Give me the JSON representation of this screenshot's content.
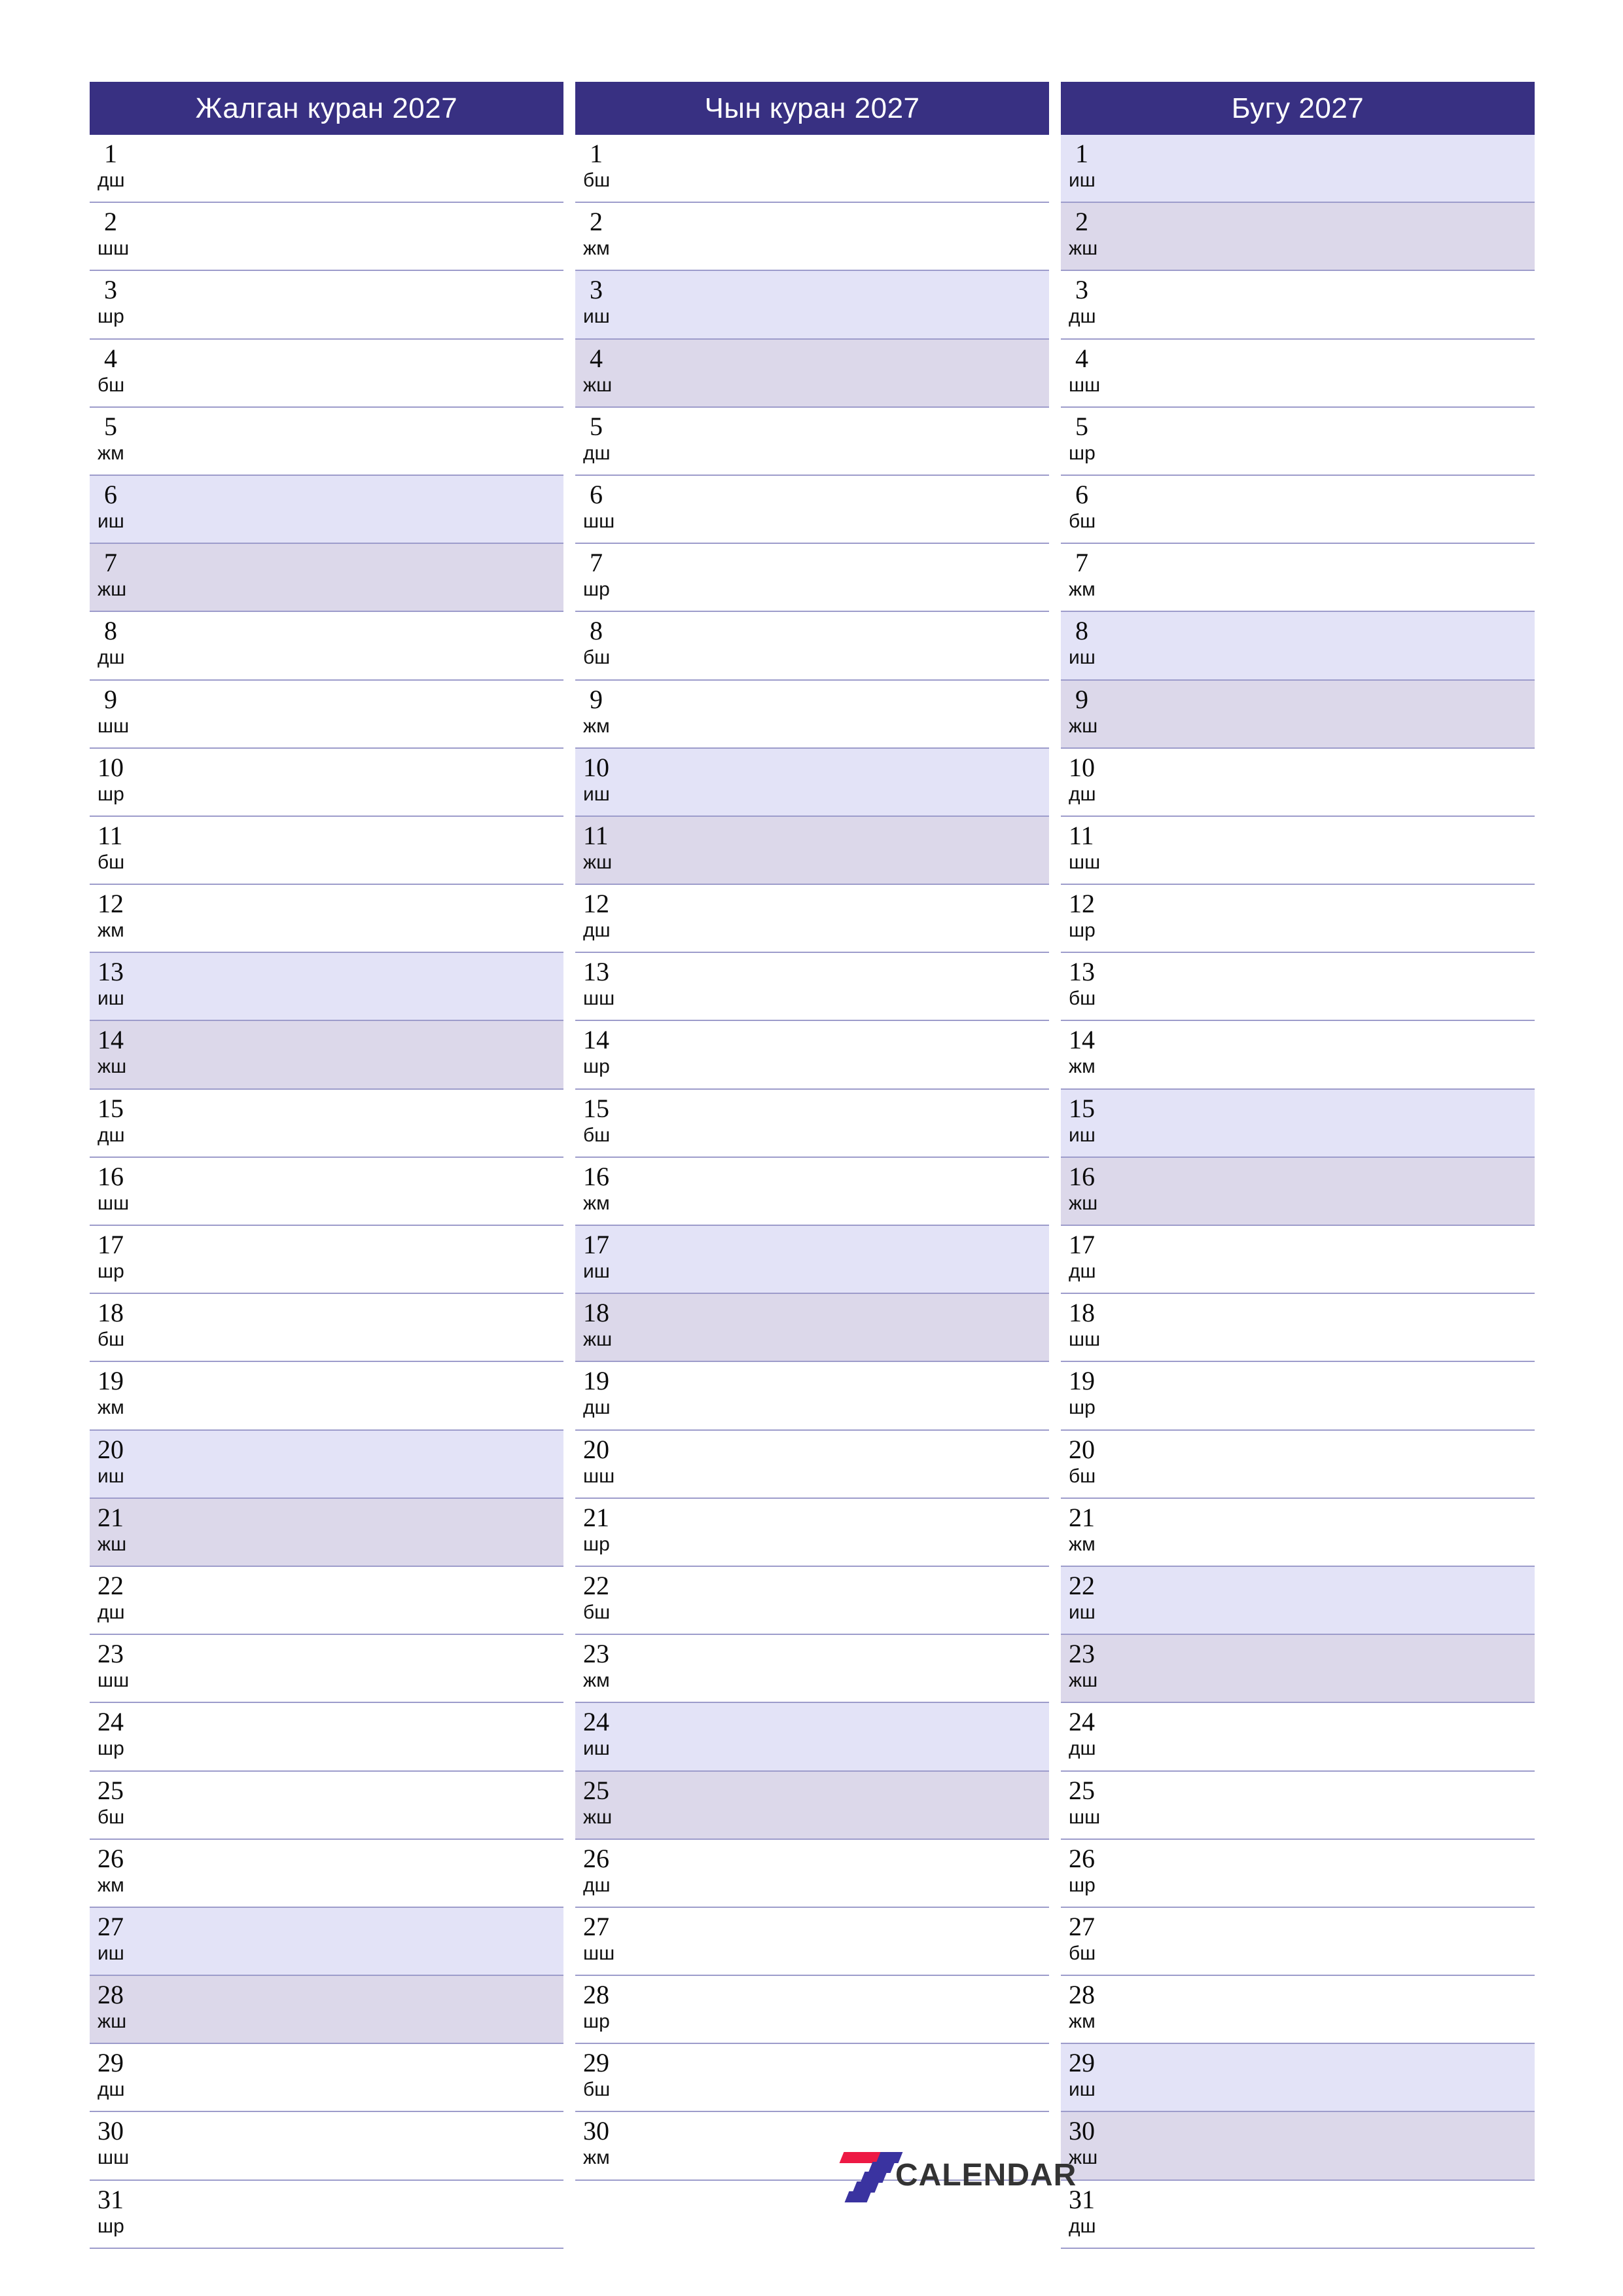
{
  "page": {
    "year": "2027",
    "header_bg": "#383082",
    "saturday_bg": "#e3e3f7",
    "sunday_bg": "#dcd8ea",
    "separator_color": "#9d9ccb"
  },
  "logo": {
    "text": "CALENDAR",
    "mark_colors": [
      "#ed1944",
      "#ed1944",
      "#3a33a0",
      "#3a33a0",
      "#3a33a0",
      "#3a33a0",
      "#3a33a0"
    ]
  },
  "weekday_abbr": {
    "monday": "дш",
    "tuesday": "шш",
    "wednesday": "шр",
    "thursday": "бш",
    "friday": "жм",
    "saturday": "иш",
    "sunday": "жш"
  },
  "months": [
    {
      "title": "Жалган куран 2027",
      "days": [
        {
          "n": "1",
          "d": "дш",
          "t": "wd"
        },
        {
          "n": "2",
          "d": "шш",
          "t": "wd"
        },
        {
          "n": "3",
          "d": "шр",
          "t": "wd"
        },
        {
          "n": "4",
          "d": "бш",
          "t": "wd"
        },
        {
          "n": "5",
          "d": "жм",
          "t": "wd"
        },
        {
          "n": "6",
          "d": "иш",
          "t": "sat"
        },
        {
          "n": "7",
          "d": "жш",
          "t": "sun"
        },
        {
          "n": "8",
          "d": "дш",
          "t": "wd"
        },
        {
          "n": "9",
          "d": "шш",
          "t": "wd"
        },
        {
          "n": "10",
          "d": "шр",
          "t": "wd"
        },
        {
          "n": "11",
          "d": "бш",
          "t": "wd"
        },
        {
          "n": "12",
          "d": "жм",
          "t": "wd"
        },
        {
          "n": "13",
          "d": "иш",
          "t": "sat"
        },
        {
          "n": "14",
          "d": "жш",
          "t": "sun"
        },
        {
          "n": "15",
          "d": "дш",
          "t": "wd"
        },
        {
          "n": "16",
          "d": "шш",
          "t": "wd"
        },
        {
          "n": "17",
          "d": "шр",
          "t": "wd"
        },
        {
          "n": "18",
          "d": "бш",
          "t": "wd"
        },
        {
          "n": "19",
          "d": "жм",
          "t": "wd"
        },
        {
          "n": "20",
          "d": "иш",
          "t": "sat"
        },
        {
          "n": "21",
          "d": "жш",
          "t": "sun"
        },
        {
          "n": "22",
          "d": "дш",
          "t": "wd"
        },
        {
          "n": "23",
          "d": "шш",
          "t": "wd"
        },
        {
          "n": "24",
          "d": "шр",
          "t": "wd"
        },
        {
          "n": "25",
          "d": "бш",
          "t": "wd"
        },
        {
          "n": "26",
          "d": "жм",
          "t": "wd"
        },
        {
          "n": "27",
          "d": "иш",
          "t": "sat"
        },
        {
          "n": "28",
          "d": "жш",
          "t": "sun"
        },
        {
          "n": "29",
          "d": "дш",
          "t": "wd"
        },
        {
          "n": "30",
          "d": "шш",
          "t": "wd"
        },
        {
          "n": "31",
          "d": "шр",
          "t": "wd"
        }
      ]
    },
    {
      "title": "Чын куран 2027",
      "days": [
        {
          "n": "1",
          "d": "бш",
          "t": "wd"
        },
        {
          "n": "2",
          "d": "жм",
          "t": "wd"
        },
        {
          "n": "3",
          "d": "иш",
          "t": "sat"
        },
        {
          "n": "4",
          "d": "жш",
          "t": "sun"
        },
        {
          "n": "5",
          "d": "дш",
          "t": "wd"
        },
        {
          "n": "6",
          "d": "шш",
          "t": "wd"
        },
        {
          "n": "7",
          "d": "шр",
          "t": "wd"
        },
        {
          "n": "8",
          "d": "бш",
          "t": "wd"
        },
        {
          "n": "9",
          "d": "жм",
          "t": "wd"
        },
        {
          "n": "10",
          "d": "иш",
          "t": "sat"
        },
        {
          "n": "11",
          "d": "жш",
          "t": "sun"
        },
        {
          "n": "12",
          "d": "дш",
          "t": "wd"
        },
        {
          "n": "13",
          "d": "шш",
          "t": "wd"
        },
        {
          "n": "14",
          "d": "шр",
          "t": "wd"
        },
        {
          "n": "15",
          "d": "бш",
          "t": "wd"
        },
        {
          "n": "16",
          "d": "жм",
          "t": "wd"
        },
        {
          "n": "17",
          "d": "иш",
          "t": "sat"
        },
        {
          "n": "18",
          "d": "жш",
          "t": "sun"
        },
        {
          "n": "19",
          "d": "дш",
          "t": "wd"
        },
        {
          "n": "20",
          "d": "шш",
          "t": "wd"
        },
        {
          "n": "21",
          "d": "шр",
          "t": "wd"
        },
        {
          "n": "22",
          "d": "бш",
          "t": "wd"
        },
        {
          "n": "23",
          "d": "жм",
          "t": "wd"
        },
        {
          "n": "24",
          "d": "иш",
          "t": "sat"
        },
        {
          "n": "25",
          "d": "жш",
          "t": "sun"
        },
        {
          "n": "26",
          "d": "дш",
          "t": "wd"
        },
        {
          "n": "27",
          "d": "шш",
          "t": "wd"
        },
        {
          "n": "28",
          "d": "шр",
          "t": "wd"
        },
        {
          "n": "29",
          "d": "бш",
          "t": "wd"
        },
        {
          "n": "30",
          "d": "жм",
          "t": "wd"
        }
      ]
    },
    {
      "title": "Бугу 2027",
      "days": [
        {
          "n": "1",
          "d": "иш",
          "t": "sat"
        },
        {
          "n": "2",
          "d": "жш",
          "t": "sun"
        },
        {
          "n": "3",
          "d": "дш",
          "t": "wd"
        },
        {
          "n": "4",
          "d": "шш",
          "t": "wd"
        },
        {
          "n": "5",
          "d": "шр",
          "t": "wd"
        },
        {
          "n": "6",
          "d": "бш",
          "t": "wd"
        },
        {
          "n": "7",
          "d": "жм",
          "t": "wd"
        },
        {
          "n": "8",
          "d": "иш",
          "t": "sat"
        },
        {
          "n": "9",
          "d": "жш",
          "t": "sun"
        },
        {
          "n": "10",
          "d": "дш",
          "t": "wd"
        },
        {
          "n": "11",
          "d": "шш",
          "t": "wd"
        },
        {
          "n": "12",
          "d": "шр",
          "t": "wd"
        },
        {
          "n": "13",
          "d": "бш",
          "t": "wd"
        },
        {
          "n": "14",
          "d": "жм",
          "t": "wd"
        },
        {
          "n": "15",
          "d": "иш",
          "t": "sat"
        },
        {
          "n": "16",
          "d": "жш",
          "t": "sun"
        },
        {
          "n": "17",
          "d": "дш",
          "t": "wd"
        },
        {
          "n": "18",
          "d": "шш",
          "t": "wd"
        },
        {
          "n": "19",
          "d": "шр",
          "t": "wd"
        },
        {
          "n": "20",
          "d": "бш",
          "t": "wd"
        },
        {
          "n": "21",
          "d": "жм",
          "t": "wd"
        },
        {
          "n": "22",
          "d": "иш",
          "t": "sat"
        },
        {
          "n": "23",
          "d": "жш",
          "t": "sun"
        },
        {
          "n": "24",
          "d": "дш",
          "t": "wd"
        },
        {
          "n": "25",
          "d": "шш",
          "t": "wd"
        },
        {
          "n": "26",
          "d": "шр",
          "t": "wd"
        },
        {
          "n": "27",
          "d": "бш",
          "t": "wd"
        },
        {
          "n": "28",
          "d": "жм",
          "t": "wd"
        },
        {
          "n": "29",
          "d": "иш",
          "t": "sat"
        },
        {
          "n": "30",
          "d": "жш",
          "t": "sun"
        },
        {
          "n": "31",
          "d": "дш",
          "t": "wd"
        }
      ]
    }
  ]
}
